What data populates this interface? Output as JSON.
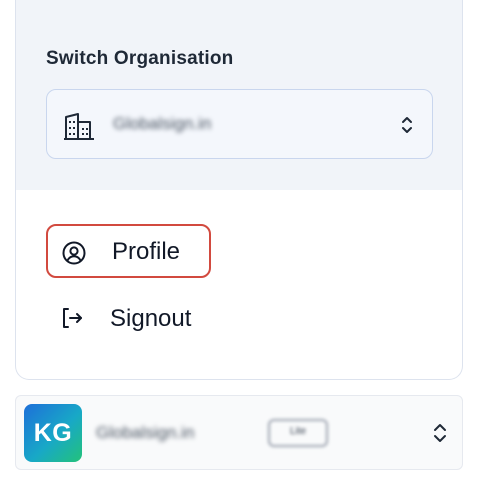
{
  "org_menu": {
    "heading": "Switch Organisation",
    "selected_org": "Globalsign.in",
    "icons": {
      "org": "building-icon",
      "select": "chevron-up-down-icon"
    }
  },
  "menu": {
    "items": [
      {
        "label": "Profile",
        "icon": "user-circle-icon",
        "highlighted": true
      },
      {
        "label": "Signout",
        "icon": "sign-out-icon",
        "highlighted": false
      }
    ]
  },
  "org_switcher": {
    "avatar_initials": "KG",
    "org_name": "Globalsign.in",
    "plan_badge": "Lite",
    "icon": "chevron-up-down-icon"
  },
  "colors": {
    "highlight_border": "#d24a3f",
    "section_bg": "#f1f4f9",
    "avatar_gradient": [
      "#1e6fd9",
      "#18a8c7",
      "#23c27a"
    ]
  }
}
